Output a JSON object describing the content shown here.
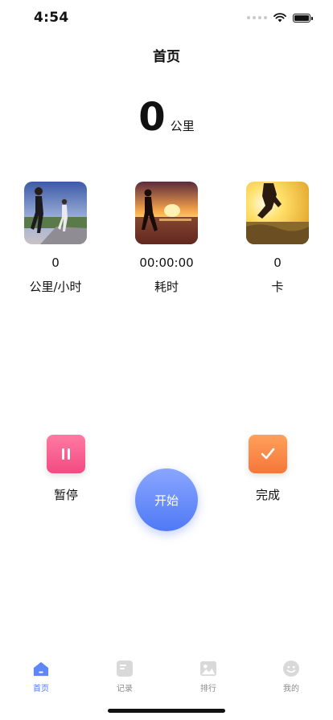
{
  "status_bar": {
    "time": "4:54"
  },
  "nav": {
    "title": "首页"
  },
  "distance": {
    "value": "0",
    "unit": "公里"
  },
  "stats": [
    {
      "value": "0",
      "label": "公里/小时",
      "image": "runners-road-photo"
    },
    {
      "value": "00:00:00",
      "label": "耗时",
      "image": "sunset-runner-photo"
    },
    {
      "value": "0",
      "label": "卡",
      "image": "sunlit-runner-photo"
    }
  ],
  "actions": {
    "pause_label": "暂停",
    "start_label": "开始",
    "done_label": "完成"
  },
  "colors": {
    "accent": "#4f79f5",
    "pause": "#f24b83",
    "done": "#f5773a",
    "tab_inactive": "#8c8c8c"
  },
  "tabbar": {
    "items": [
      {
        "label": "首页",
        "icon": "home-icon",
        "active": true
      },
      {
        "label": "记录",
        "icon": "record-icon",
        "active": false
      },
      {
        "label": "排行",
        "icon": "ranking-icon",
        "active": false
      },
      {
        "label": "我的",
        "icon": "profile-icon",
        "active": false
      }
    ]
  }
}
